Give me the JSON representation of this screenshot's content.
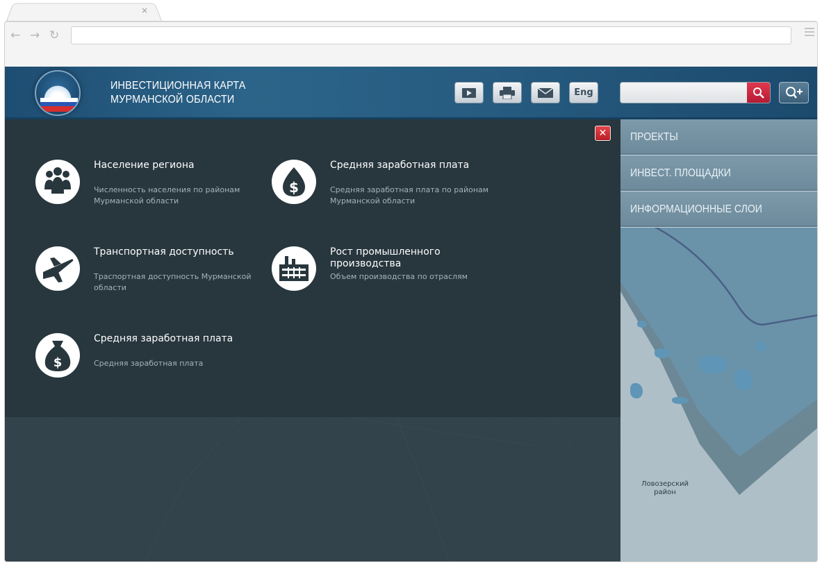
{
  "browser": {
    "close_glyph": "×",
    "back_glyph": "←",
    "forward_glyph": "→",
    "reload_glyph": "↻",
    "url_value": ""
  },
  "header": {
    "title_line1": "ИНВЕСТИЦИОННАЯ КАРТА",
    "title_line2": "МУРМАНСКОЙ ОБЛАСТИ",
    "lang_label": "Eng",
    "search_placeholder": "",
    "buttons": [
      "video-icon",
      "print-icon",
      "mail-icon",
      "language-button"
    ]
  },
  "sidebar": {
    "items": [
      {
        "label": "ПРОЕКТЫ"
      },
      {
        "label": "ИНВЕСТ. ПЛОЩАДКИ"
      },
      {
        "label": "ИНФОРМАЦИОННЫЕ СЛОИ"
      }
    ]
  },
  "map": {
    "labels": {
      "lovozero": "Ловозерский район"
    }
  },
  "panel": {
    "close_glyph": "✕",
    "items": [
      {
        "title": "Население региона",
        "desc": "Численность населения по районам Мурманской области",
        "icon": "people-icon"
      },
      {
        "title": "Средняя заработная плата",
        "desc": "Средняя заработная плата по районам Мурманской области",
        "icon": "money-drop-icon"
      },
      {
        "title": "Транспортная доступность",
        "desc": "Траспортная доступность Мурманской области",
        "icon": "airplane-icon"
      },
      {
        "title": "Рост промышленного производства",
        "desc": "Объем производства по отраслям",
        "icon": "factory-icon"
      },
      {
        "title": "Средняя заработная плата",
        "desc": "Средняя заработная плата",
        "icon": "money-bag-icon"
      }
    ]
  },
  "colors": {
    "header": "#275b80",
    "panel": "#28363d",
    "search_button": "#c7243a",
    "close_button": "#c92a32"
  }
}
